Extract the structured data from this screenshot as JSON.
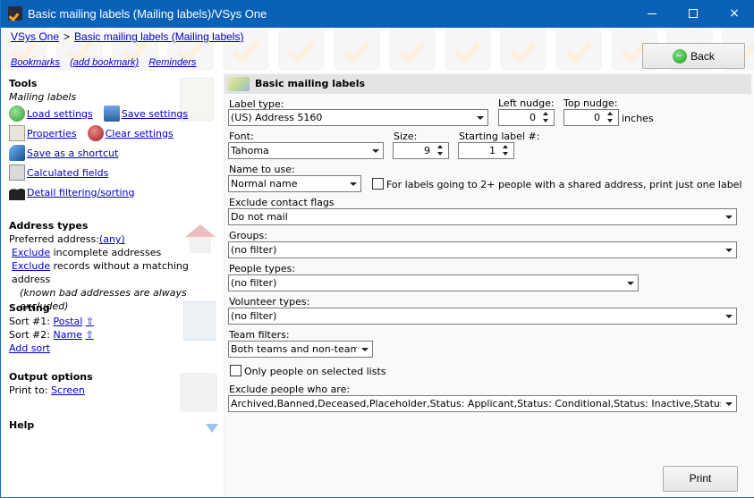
{
  "window": {
    "title": "Basic mailing labels (Mailing labels)/VSys One",
    "controls": {
      "minimize": "minimize",
      "maximize": "maximize",
      "close": "×"
    }
  },
  "header": {
    "breadcrumb": [
      "VSys One",
      "Basic mailing labels (Mailing labels)"
    ],
    "breadcrumb_sep": ">",
    "bookmarks": [
      "Bookmarks",
      "(add bookmark)",
      "Reminders"
    ],
    "back_label": "Back"
  },
  "sidebar": {
    "tools": {
      "title": "Tools",
      "subtitle": "Mailing labels",
      "load": "Load settings",
      "save": "Save settings",
      "properties": "Properties",
      "clear": "Clear settings",
      "shortcut": "Save as a shortcut",
      "calculated": "Calculated fields",
      "detail": "Detail filtering/sorting"
    },
    "address": {
      "title": "Address types",
      "preferred_label": "Preferred address:",
      "preferred_value": "(any)",
      "exclude_link": "Exclude",
      "incomplete_text": "incomplete addresses",
      "nomatch_text": "records without a matching address",
      "note": "(known bad addresses are always excluded)"
    },
    "sorting": {
      "title": "Sorting",
      "sort1_label": "Sort #1:",
      "sort1_value": "Postal",
      "sort2_label": "Sort #2:",
      "sort2_value": "Name",
      "sort_dir_glyph": "⇧",
      "add_sort": "Add sort"
    },
    "output": {
      "title": "Output options",
      "print_to_label": "Print to:",
      "print_to_value": "Screen"
    },
    "help": {
      "title": "Help"
    }
  },
  "form": {
    "panel_title": "Basic mailing labels",
    "label_type": {
      "label": "Label type:",
      "value": "(US) Address 5160"
    },
    "left_nudge": {
      "label": "Left nudge:",
      "value": "0"
    },
    "top_nudge": {
      "label": "Top nudge:",
      "value": "0",
      "unit": "inches"
    },
    "font": {
      "label": "Font:",
      "value": "Tahoma"
    },
    "size": {
      "label": "Size:",
      "value": "9"
    },
    "starting_label": {
      "label": "Starting label #:",
      "value": "1"
    },
    "name_to_use": {
      "label": "Name to use:",
      "value": "Normal name"
    },
    "shared_address": {
      "label": "For labels going to 2+ people with a shared address, print just one label",
      "checked": false
    },
    "exclude_flags": {
      "label": "Exclude contact flags",
      "value": "Do not mail"
    },
    "groups": {
      "label": "Groups:",
      "value": "(no filter)"
    },
    "people_types": {
      "label": "People types:",
      "value": "(no filter)"
    },
    "volunteer_types": {
      "label": "Volunteer types:",
      "value": "(no filter)"
    },
    "team_filters": {
      "label": "Team filters:",
      "value": "Both teams and non-teams"
    },
    "selected_lists": {
      "label": "Only people on selected lists",
      "checked": false
    },
    "exclude_people": {
      "label": "Exclude people who are:",
      "value": "Archived,Banned,Deceased,Placeholder,Status: Applicant,Status: Conditional,Status: Inactive,Status: Leave of absence"
    },
    "print_label": "Print"
  }
}
